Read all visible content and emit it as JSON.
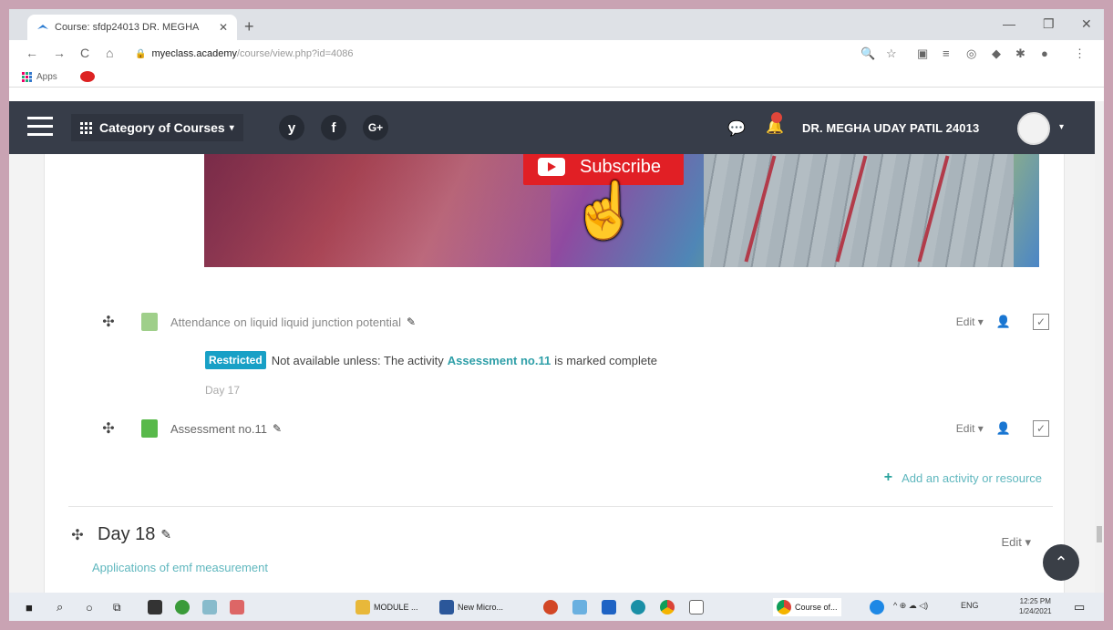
{
  "browser": {
    "tab_title": "Course: sfdp24013 DR. MEGHA",
    "tab_close": "✕",
    "new_tab": "+",
    "window_controls": [
      "—",
      "❐",
      "✕"
    ],
    "nav": [
      "←",
      "→",
      "C",
      "⌂"
    ],
    "url_host": "myeclass.academy",
    "url_path": "/course/view.php?id=4086",
    "toolbar_icons": [
      "🔍",
      "☆",
      "▣",
      "≡",
      "◎",
      "◆",
      "✱",
      "●",
      "⋮"
    ],
    "bookmarks": {
      "apps_label": "Apps"
    }
  },
  "navbar": {
    "category_label": "Category of Courses",
    "category_caret": "▾",
    "social": [
      "y",
      "f",
      "G+"
    ],
    "username": "DR. MEGHA UDAY PATIL 24013",
    "user_caret": "▾"
  },
  "banner": {
    "subscribe_label": "Subscribe",
    "cursor": "☝"
  },
  "activities": [
    {
      "name": "Attendance on liquid liquid junction potential",
      "edit": "Edit ▾",
      "icon_color": "#9fcf8a"
    },
    {
      "name": "Assessment no.11",
      "edit": "Edit ▾",
      "icon_color": "#58b94a"
    }
  ],
  "restriction": {
    "badge": "Restricted",
    "prefix": "Not available unless: The activity",
    "activity_link": "Assessment no.11",
    "suffix": "is marked complete"
  },
  "day_note": "Day 17",
  "add_activity_label": "Add an activity or resource",
  "section": {
    "title": "Day 18",
    "edit": "Edit ▾",
    "summary": "Applications of emf measurement"
  },
  "taskbar": {
    "items": [
      {
        "label": "MODULE ..."
      },
      {
        "label": "New Micro..."
      },
      {
        "label": "Course of..."
      }
    ],
    "tray_text": "ENG",
    "time": "12:25 PM",
    "date": "1/24/2021"
  },
  "colors": {
    "navbar_bg": "#373d49",
    "accent_teal": "#2aa39d",
    "restricted_badge": "#18a0c6",
    "subscribe_red": "#e11f25"
  }
}
